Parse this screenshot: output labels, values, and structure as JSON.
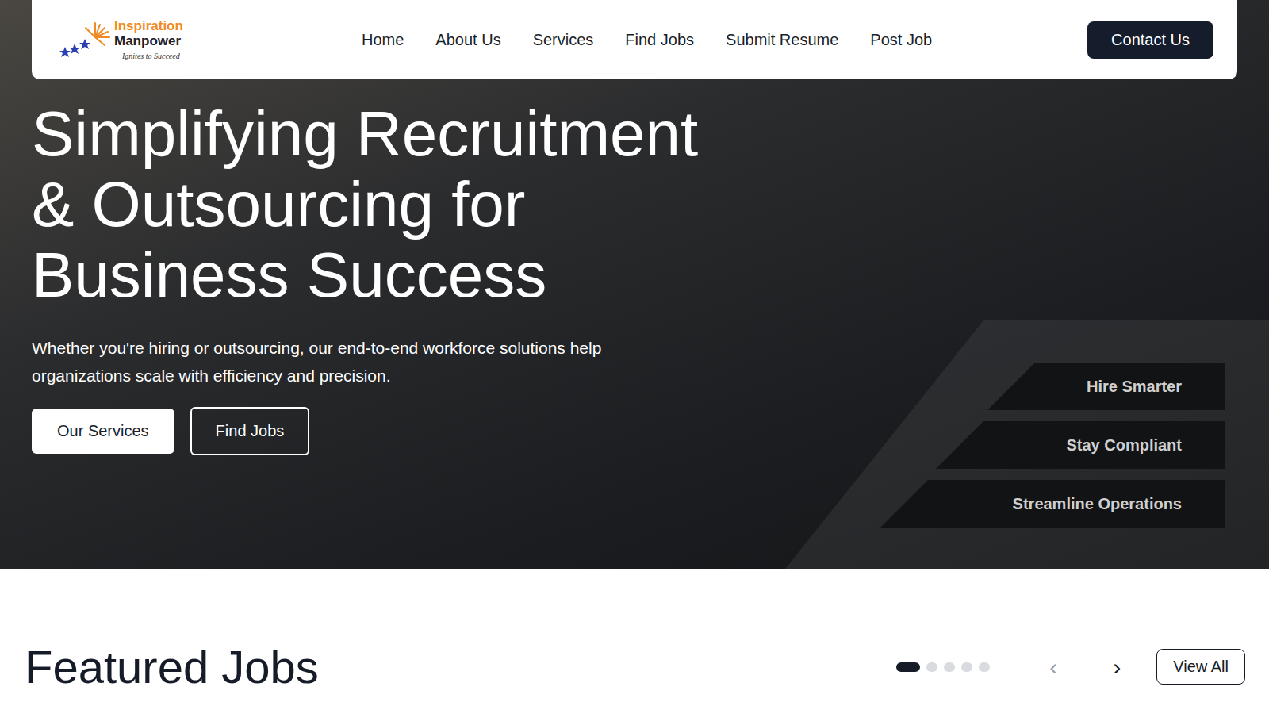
{
  "logo": {
    "line1": "Inspiration",
    "line2": "Manpower",
    "tagline": "Ignites to Succeed"
  },
  "nav": [
    "Home",
    "About Us",
    "Services",
    "Find Jobs",
    "Submit Resume",
    "Post Job"
  ],
  "contact_button": "Contact Us",
  "hero": {
    "title_lines": [
      "Simplifying Recruitment",
      "& Outsourcing for",
      "Business Success"
    ],
    "subtitle": "Whether you're hiring or outsourcing, our end-to-end workforce solutions help organizations scale with efficiency and precision.",
    "buttons": [
      {
        "label": "Our Services",
        "kind": "solid"
      },
      {
        "label": "Find Jobs",
        "kind": "outline"
      }
    ],
    "highlights": [
      "Hire Smarter",
      "Stay Compliant",
      "Streamline Operations"
    ]
  },
  "featured": {
    "title": "Featured Jobs",
    "pages": [
      {
        "selected": true
      },
      {
        "selected": false
      },
      {
        "selected": false
      },
      {
        "selected": false
      },
      {
        "selected": false
      }
    ],
    "prev": {
      "icon": "‹",
      "disabled": true
    },
    "next": {
      "icon": "›",
      "disabled": false
    },
    "view_all": "View All"
  }
}
